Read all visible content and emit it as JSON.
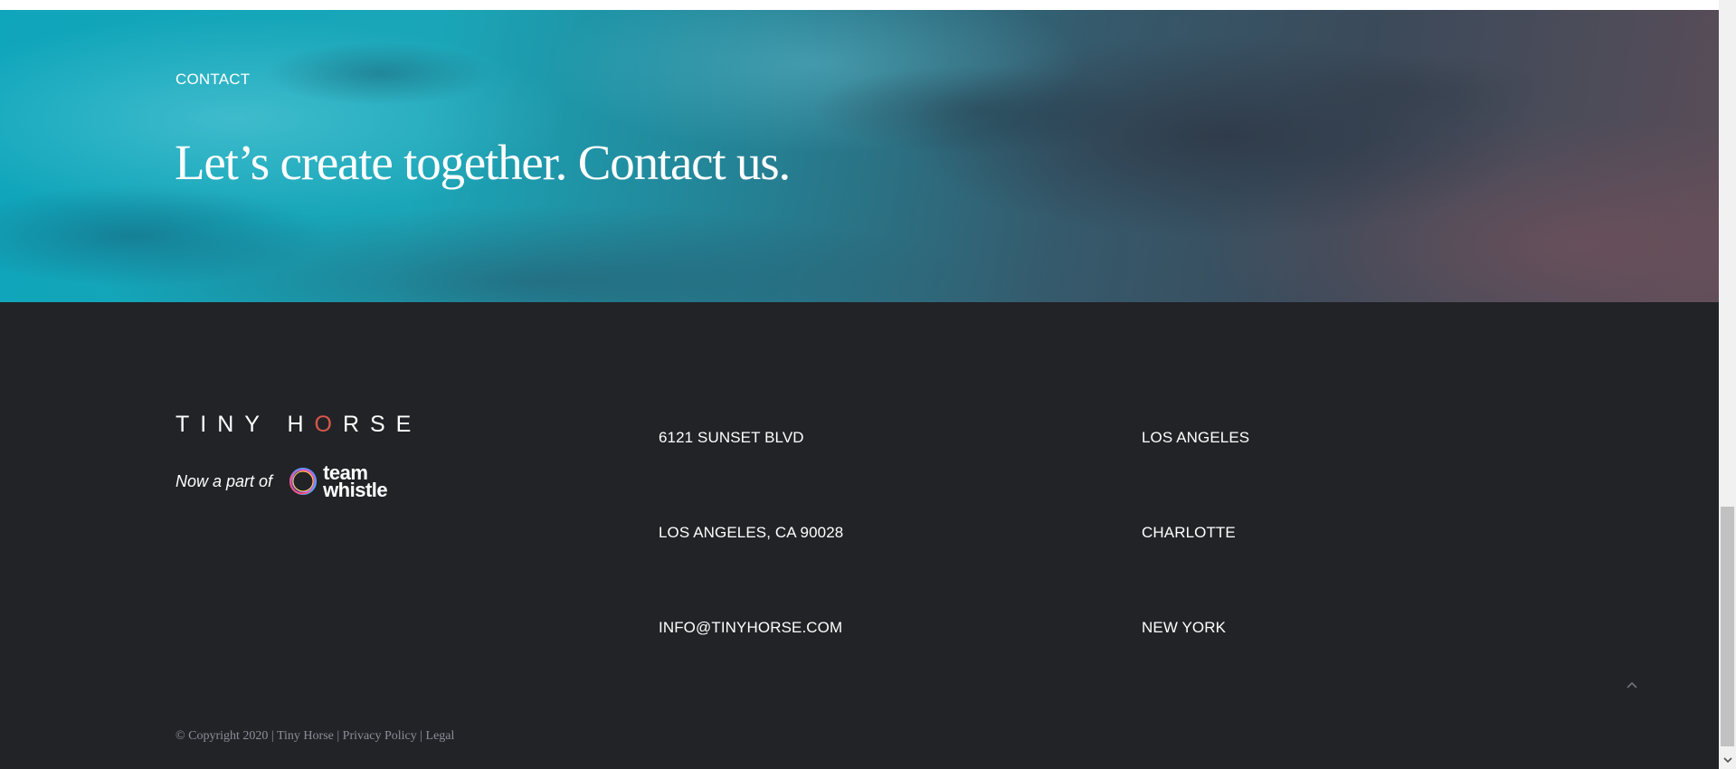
{
  "hero": {
    "eyebrow": "CONTACT",
    "headline": "Let’s create together. Contact us."
  },
  "brand": {
    "logo_before": "TINY H",
    "logo_o": "O",
    "logo_after": "RSE",
    "partner_text": "Now a part of",
    "partner_word_1": "team",
    "partner_word_2": "whistle"
  },
  "contact": {
    "address_line_1": "6121 SUNSET BLVD",
    "address_line_2": "LOS ANGELES, CA 90028",
    "email": "INFO@TINYHORSE.COM"
  },
  "locations": [
    "LOS ANGELES",
    "CHARLOTTE",
    "NEW YORK"
  ],
  "legal": {
    "copyright": "© Copyright 2020 | ",
    "company_link": "Tiny Horse",
    "separator": " | ",
    "privacy": "Privacy Policy",
    "legal_link": "Legal"
  },
  "icons": {
    "back_to_top": "chevron-up-icon",
    "scroll_down": "scroll-down-arrow-icon",
    "partner_logo": "team-whistle-ring-icon"
  },
  "colors": {
    "footer_bg": "#222327",
    "logo_accent": "#d9574a",
    "legal_text": "#8b8f98"
  }
}
